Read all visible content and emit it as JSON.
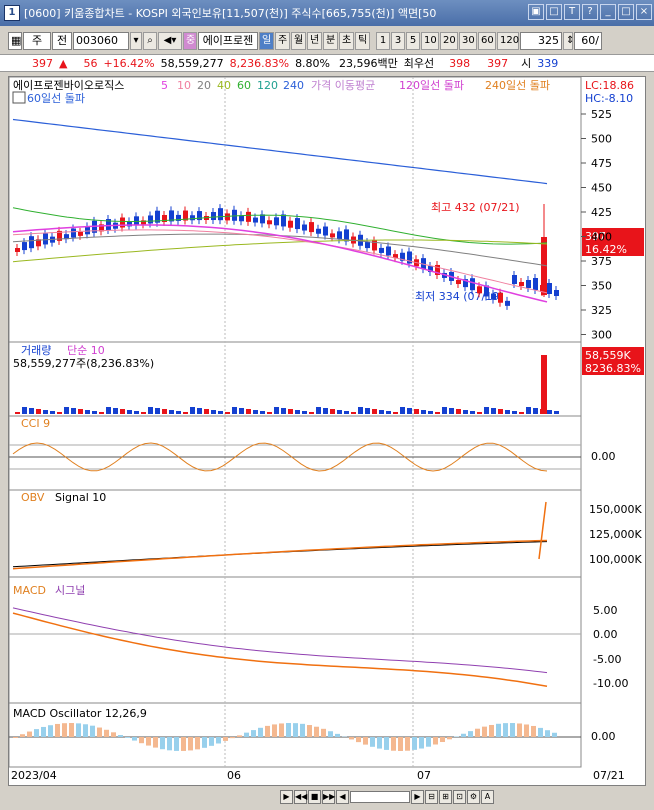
{
  "window": {
    "title_num": "1",
    "title": "[0600] 키움종합차트 - KOSPI 외국인보유[11,507(천)] 주식수[665,755(천)] 액면[50",
    "buttons": [
      "▣",
      "□",
      "T",
      "?",
      "_",
      "□",
      "×"
    ]
  },
  "toolbar": {
    "period": "주",
    "mode": "전",
    "code": "003060",
    "stock_name": "에이프로젠",
    "tf_buttons": [
      "일",
      "주",
      "월",
      "년",
      "분",
      "초",
      "틱"
    ],
    "num_buttons": [
      "1",
      "3",
      "5",
      "10",
      "20",
      "30",
      "60",
      "120"
    ],
    "count_value": "325",
    "right_value": "60/"
  },
  "info": {
    "price": "397",
    "change": "56",
    "change_pct": "+16.42%",
    "volume": "58,559,277",
    "vol_ratio": "8,236.83%",
    "turnover": "8.80%",
    "amount": "23,596백만",
    "pref_label": "최우선",
    "pref_ask": "398",
    "pref_bid": "397",
    "open_label": "시",
    "open": "339"
  },
  "price_panel": {
    "stock_label": "에이프로젠바이오로직스",
    "ma_periods": [
      "5",
      "10",
      "20",
      "40",
      "60",
      "120",
      "240"
    ],
    "ma_label": "가격 이동평균",
    "break120": "120일선 돌파",
    "break240": "240일선 돌파",
    "break60": "60일선 돌파",
    "lc": "LC:18.86",
    "hc": "HC:-8.10",
    "high_label": "최고 432 (07/21)",
    "low_label": "최저 334 (07/19)",
    "last_price": "397",
    "last_pct": "16.42%",
    "axis": [
      "525",
      "500",
      "475",
      "450",
      "425",
      "400",
      "375",
      "350",
      "325",
      "300"
    ]
  },
  "volume_panel": {
    "label": "거래량",
    "ma_label": "단순 10",
    "value": "58,559,277주(8,236.83%)",
    "tag": "58,559K",
    "tag_pct": "8236.83%"
  },
  "cci_panel": {
    "label": "CCI 9",
    "axis": [
      "0.00"
    ]
  },
  "obv_panel": {
    "label": "OBV",
    "signal": "Signal 10",
    "axis": [
      "150,000K",
      "125,000K",
      "100,000K"
    ]
  },
  "macd_panel": {
    "label": "MACD",
    "signal": "시그널",
    "axis": [
      "5.00",
      "0.00",
      "-5.00",
      "-10.00"
    ]
  },
  "osc_panel": {
    "label": "MACD Oscillator 12,26,9",
    "axis": [
      "0.00"
    ]
  },
  "date_axis": [
    "2023/04",
    "06",
    "07",
    "07/21"
  ],
  "colors": {
    "up": "#e8141a",
    "down": "#1440d0",
    "ma5": "#e040e0",
    "ma240": "#2b5fd8",
    "obv": "#f07010",
    "osc": "#98d0ec"
  }
}
